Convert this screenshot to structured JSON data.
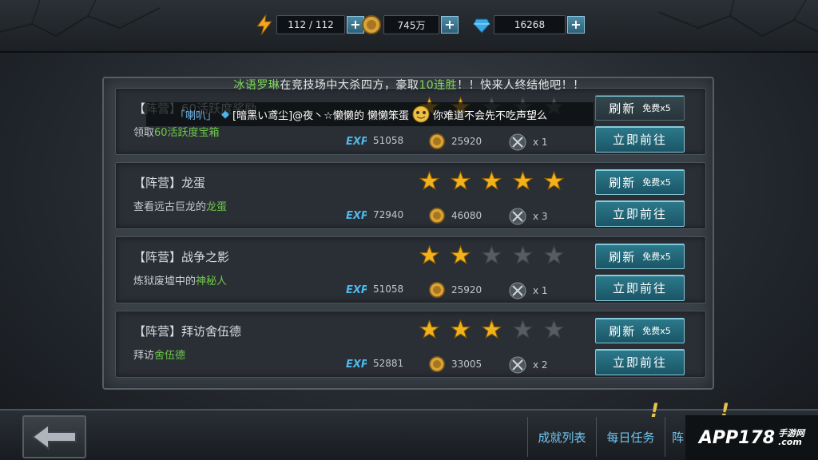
{
  "resources": {
    "stamina": "112 / 112",
    "gold": "745万",
    "gems": "16268",
    "plus": "+"
  },
  "notice": {
    "part1": "冰语罗琳",
    "part2": "在竞技场中大杀四方，豪取",
    "part3": "10连胜",
    "part4": "！！快来人终结他吧！！"
  },
  "chat": {
    "tag": "「喇叭」",
    "player": "[暗黑い鸢尘]@夜丶☆懒懒的 懒懒笨蛋",
    "message": "你难道不会先不吃声望么"
  },
  "tasks": [
    {
      "title": "【阵营】60活跃度奖励",
      "desc_prefix": "领取",
      "desc_highlight": "60活跃度宝箱",
      "desc_suffix": "",
      "stars": 2,
      "exp": "51058",
      "gold": "25920",
      "item": "x 1",
      "refresh_label": "刷新",
      "free_label": "免费x5",
      "go_label": "立即前往"
    },
    {
      "title": "【阵营】龙蛋",
      "desc_prefix": "查看远古巨龙的",
      "desc_highlight": "龙蛋",
      "desc_suffix": "",
      "stars": 5,
      "exp": "72940",
      "gold": "46080",
      "item": "x 3",
      "refresh_label": "刷新",
      "free_label": "免费x5",
      "go_label": "立即前往"
    },
    {
      "title": "【阵营】战争之影",
      "desc_prefix": "炼狱废墟中的",
      "desc_highlight": "神秘人",
      "desc_suffix": "",
      "stars": 2,
      "exp": "51058",
      "gold": "25920",
      "item": "x 1",
      "refresh_label": "刷新",
      "free_label": "免费x5",
      "go_label": "立即前往"
    },
    {
      "title": "【阵营】拜访舍伍德",
      "desc_prefix": "拜访",
      "desc_highlight": "舍伍德",
      "desc_suffix": "",
      "stars": 3,
      "exp": "52881",
      "gold": "33005",
      "item": "x 2",
      "refresh_label": "刷新",
      "free_label": "免费x5",
      "go_label": "立即前往"
    }
  ],
  "bottom_tabs": {
    "achievements": "成就列表",
    "daily": "每日任务",
    "faction": "阵"
  },
  "logo": {
    "main": "APP178",
    "sub": "手游网",
    "com": ".com"
  },
  "colors": {
    "accent": "#2c7a8c",
    "highlight_green": "#6ec84a",
    "star_gold": "#f2b21c"
  },
  "icons": [
    "lightning-icon",
    "gold-coin-icon",
    "gem-icon",
    "exp-icon",
    "crossed-swords-icon",
    "back-arrow-icon",
    "star-icon"
  ]
}
